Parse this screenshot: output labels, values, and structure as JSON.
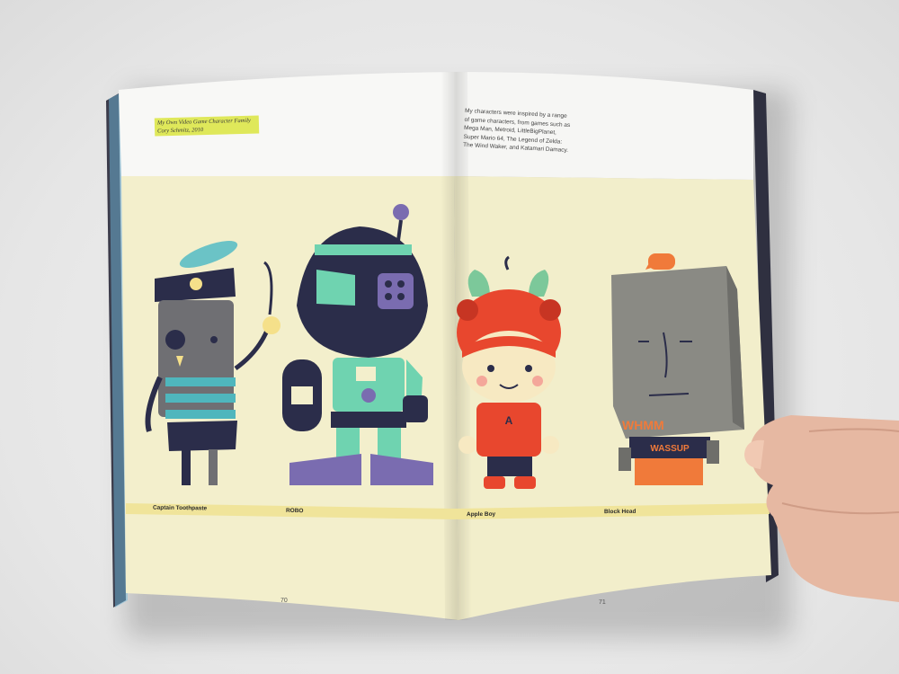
{
  "credit": {
    "line1": "My Own Video Game Character Family",
    "line2": "Cory Schmitz, 2010"
  },
  "intro_text": "My characters were inspired by a range of game characters, from games such as Mega Man, Metroid, LittleBigPlanet, Super Mario 64, The Legend of Zelda: The Wind Waker, and Katamari Damacy.",
  "characters": [
    {
      "name": "Captain Toothpaste"
    },
    {
      "name": "ROBO"
    },
    {
      "name": "Apple Boy"
    },
    {
      "name": "Block Head"
    }
  ],
  "page_numbers": {
    "left": "70",
    "right": "71"
  },
  "graffiti": {
    "tag": "WHMM",
    "shirt": "WASSUP"
  },
  "colors": {
    "page_cream": "#f3efcc",
    "page_white": "#f7f7f5",
    "label_band": "#f0e49a",
    "teal": "#6fd3b0",
    "navy": "#2b2d4a",
    "purple": "#7a6cb0",
    "red": "#e8472e",
    "orange": "#f07a3a",
    "gray": "#8a8a84"
  }
}
